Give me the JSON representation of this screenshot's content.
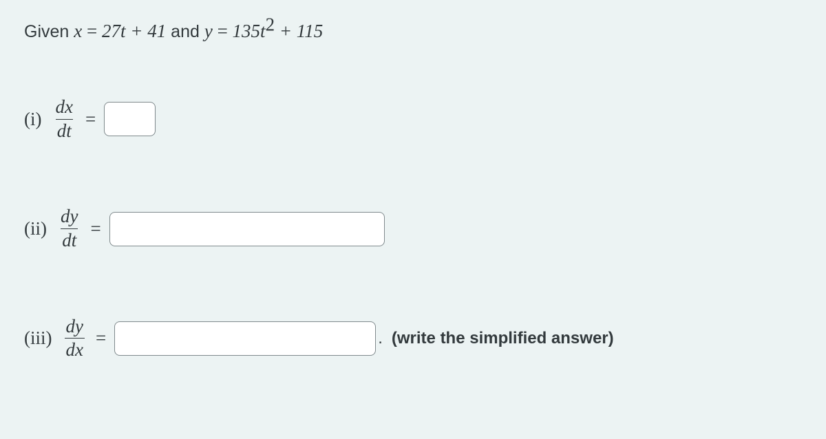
{
  "statement": {
    "prefix": "Given ",
    "eq1_lhs_var": "x",
    "eq1_eq": " = ",
    "eq1_rhs": "27t + 41",
    "connector": " and ",
    "eq2_lhs_var": "y",
    "eq2_eq": " = ",
    "eq2_rhs_a": "135t",
    "eq2_rhs_exp": "2",
    "eq2_rhs_b": " + 115"
  },
  "parts": {
    "i": {
      "label": "(i)",
      "num": "dx",
      "den": "dt",
      "equals": "="
    },
    "ii": {
      "label": "(ii)",
      "num": "dy",
      "den": "dt",
      "equals": "="
    },
    "iii": {
      "label": "(iii)",
      "num": "dy",
      "den": "dx",
      "equals": "=",
      "period": ".",
      "hint": "(write the simplified answer)"
    }
  }
}
